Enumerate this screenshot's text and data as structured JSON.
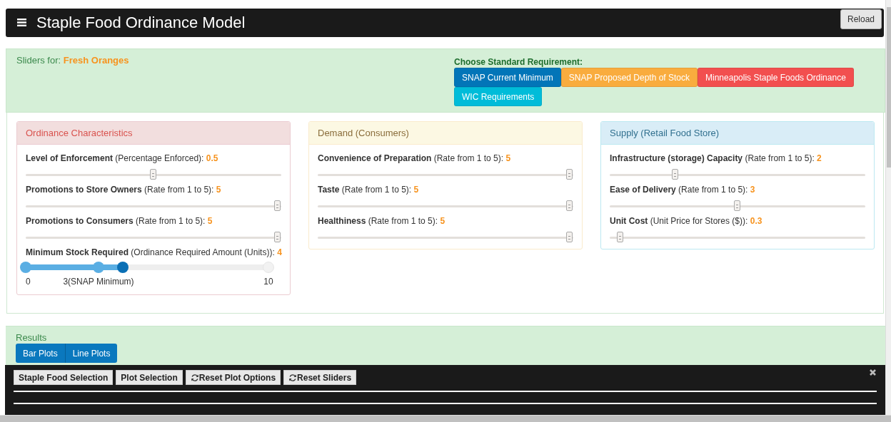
{
  "header": {
    "title": "Staple Food Ordinance Model",
    "reload_button": "Reload"
  },
  "selection": {
    "label": "Sliders for:",
    "food": "Fresh Oranges",
    "requirement_title": "Choose Standard Requirement:",
    "requirements": [
      {
        "label": "SNAP Current Minimum",
        "color": "#0275b8"
      },
      {
        "label": "SNAP Proposed Depth of Stock",
        "color": "#f9ac3e"
      },
      {
        "label": "Minneapolis Staple Foods Ordinance",
        "color": "#f24f4f"
      },
      {
        "label": "WIC Requirements",
        "color": "#00bcd9"
      }
    ]
  },
  "panels": [
    {
      "title": "Ordinance Characteristics",
      "kind": "danger",
      "sliders": [
        {
          "kind": "single",
          "label": "**Level of Enforcement** (Percentage Enforced):",
          "value": "0.5",
          "level": 0.5
        },
        {
          "kind": "single",
          "label": "**Promotions to Store Owners** (Rate from 1 to 5):",
          "value": "5",
          "level": 1
        },
        {
          "kind": "single",
          "label": "**Promotions to Consumers** (Rate from 1 to 5):",
          "value": "5",
          "level": 1
        },
        {
          "kind": "range",
          "label": "**Minimum Stock Required** (Ordinance Required Amount (Units)):",
          "value": "4",
          "handles": [
            {
              "kind": "marker",
              "label": "0",
              "level": 0
            },
            {
              "kind": "marker",
              "label": "3(SNAP Minimum)",
              "level": 0.3
            },
            {
              "kind": "value",
              "level": 0.4
            },
            {
              "kind": "end",
              "label": "10",
              "level": 1
            }
          ]
        }
      ]
    },
    {
      "title": "Demand (Consumers)",
      "kind": "warning",
      "sliders": [
        {
          "kind": "single",
          "label": "**Convenience of Preparation** (Rate from 1 to 5):",
          "value": "5",
          "level": 1
        },
        {
          "kind": "single",
          "label": "**Taste** (Rate from 1 to 5):",
          "value": "5",
          "level": 1
        },
        {
          "kind": "single",
          "label": "**Healthiness** (Rate from 1 to 5):",
          "value": "5",
          "level": 1
        }
      ]
    },
    {
      "title": "Supply (Retail Food Store)",
      "kind": "info",
      "sliders": [
        {
          "kind": "single",
          "label": "**Infrastructure (storage) Capacity** (Rate from 1 to 5):",
          "value": "2",
          "level": 0.25
        },
        {
          "kind": "single",
          "label": "**Ease of Delivery** (Rate from 1 to 5):",
          "value": "3",
          "level": 0.5
        },
        {
          "kind": "single",
          "label": "**Unit Cost** (Unit Price for Stores ($)):",
          "value": "0.3",
          "level": 0.03
        }
      ]
    }
  ],
  "results": {
    "title": "Results",
    "tabs": [
      {
        "label": "Bar Plots"
      },
      {
        "label": "Line Plots"
      }
    ]
  },
  "toolbar": {
    "buttons": [
      {
        "label": "Staple Food Selection",
        "kind": "plain"
      },
      {
        "label": "Plot Selection",
        "kind": "plain"
      },
      {
        "label": "Reset Plot Options",
        "kind": "reset"
      },
      {
        "label": "Reset Sliders",
        "kind": "reset"
      }
    ]
  }
}
